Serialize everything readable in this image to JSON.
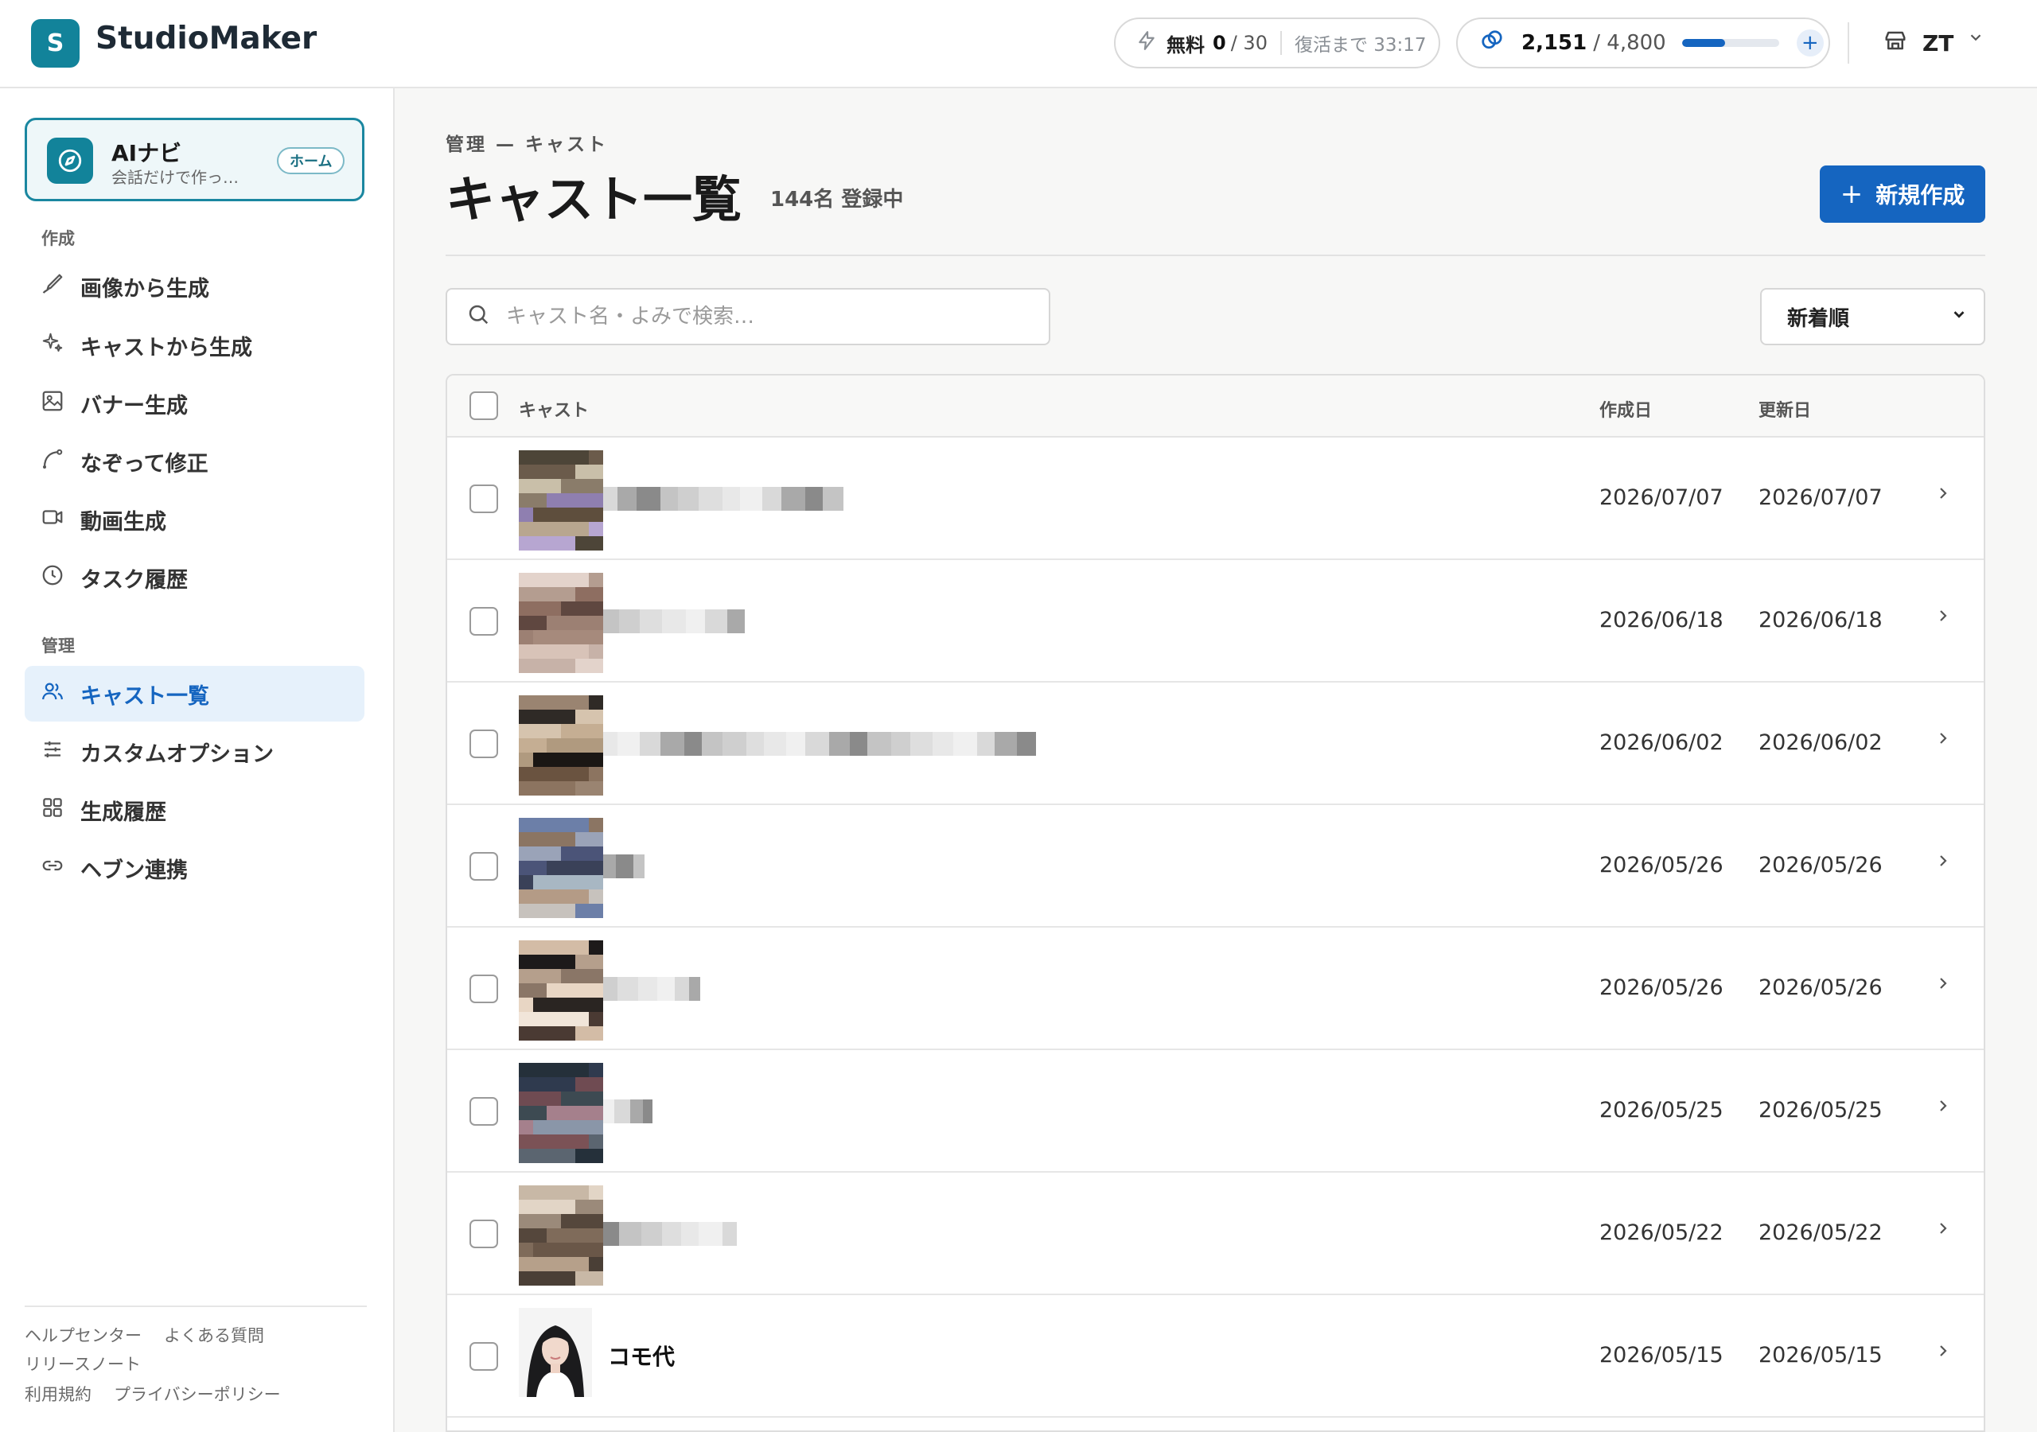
{
  "header": {
    "logo_letter": "S",
    "brand": "StudioMaker",
    "quota": {
      "label": "無料",
      "used": "0",
      "total": "/ 30",
      "recover": "復活まで 33:17"
    },
    "credits": {
      "current": "2,151",
      "total": "/ 4,800",
      "progress": 0.448,
      "accent": "#1565c0"
    },
    "user": "ZT"
  },
  "sidebar": {
    "ai_card": {
      "title": "AIナビ",
      "subtitle": "会話だけで作っ…",
      "home": "ホーム"
    },
    "sections": {
      "create": "作成",
      "manage": "管理"
    },
    "create_items": [
      {
        "label": "画像から生成",
        "icon": "brush-icon"
      },
      {
        "label": "キャストから生成",
        "icon": "sparkle-icon"
      },
      {
        "label": "バナー生成",
        "icon": "image-icon"
      },
      {
        "label": "なぞって修正",
        "icon": "trace-icon"
      },
      {
        "label": "動画生成",
        "icon": "video-icon"
      },
      {
        "label": "タスク履歴",
        "icon": "clock-icon"
      }
    ],
    "manage_items": [
      {
        "label": "キャスト一覧",
        "icon": "users-icon",
        "active": true
      },
      {
        "label": "カスタムオプション",
        "icon": "sliders-icon"
      },
      {
        "label": "生成履歴",
        "icon": "grid-icon"
      },
      {
        "label": "ヘブン連携",
        "icon": "link-icon"
      }
    ],
    "footer": {
      "help": "ヘルプセンター",
      "faq": "よくある質問",
      "release": "リリースノート",
      "terms": "利用規約",
      "privacy": "プライバシーポリシー"
    }
  },
  "main": {
    "breadcrumb": "管理 — キャスト",
    "title": "キャスト一覧",
    "count": "144名 登録中",
    "new_button": "新規作成",
    "search_placeholder": "キャスト名・よみで検索…",
    "sort_value": "新着順",
    "columns": {
      "cast": "キャスト",
      "created": "作成日",
      "updated": "更新日"
    },
    "rows": [
      {
        "name": "",
        "created": "2026/07/07",
        "updated": "2026/07/07"
      },
      {
        "name": "",
        "created": "2026/06/18",
        "updated": "2026/06/18"
      },
      {
        "name": "",
        "created": "2026/06/02",
        "updated": "2026/06/02"
      },
      {
        "name": "",
        "created": "2026/05/26",
        "updated": "2026/05/26"
      },
      {
        "name": "",
        "created": "2026/05/26",
        "updated": "2026/05/26"
      },
      {
        "name": "",
        "created": "2026/05/25",
        "updated": "2026/05/25"
      },
      {
        "name": "",
        "created": "2026/05/22",
        "updated": "2026/05/22"
      },
      {
        "name": "コモ代",
        "created": "2026/05/15",
        "updated": "2026/05/15"
      }
    ]
  }
}
